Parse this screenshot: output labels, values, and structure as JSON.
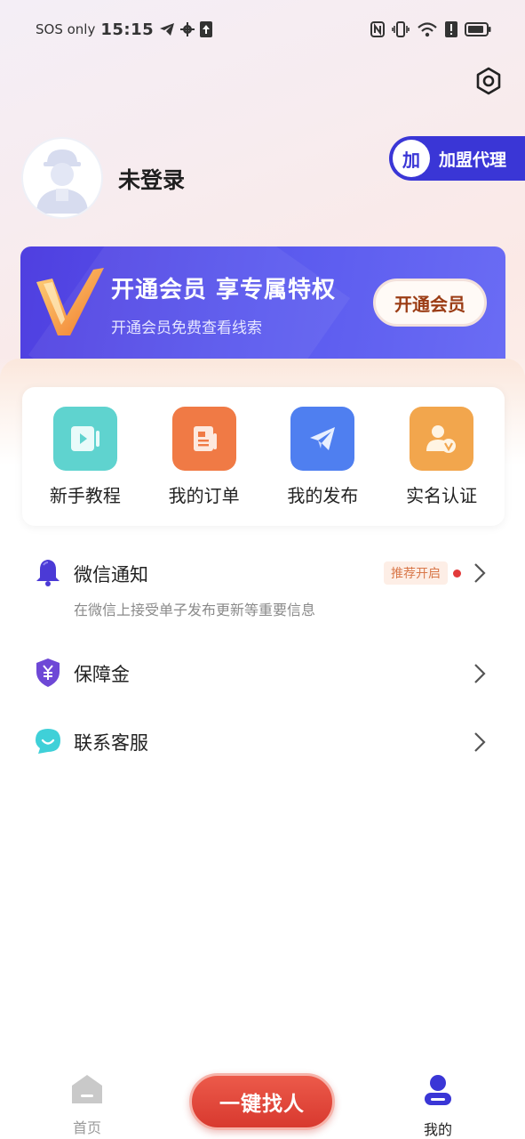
{
  "status_bar": {
    "carrier": "SOS only",
    "time": "15:15",
    "icons": [
      "telegram-icon",
      "gear-icon",
      "upload-icon",
      "nfc-icon",
      "vibrate-icon",
      "wifi-icon",
      "alert-icon",
      "battery-icon"
    ]
  },
  "profile": {
    "username": "未登录",
    "agent_badge": "加",
    "agent_label": "加盟代理"
  },
  "vip": {
    "title": "开通会员 享专属特权",
    "subtitle": "开通会员免费查看线索",
    "button": "开通会员"
  },
  "shortcuts": [
    {
      "label": "新手教程",
      "icon": "video-tutorial-icon",
      "color": "#5fd3cf"
    },
    {
      "label": "我的订单",
      "icon": "order-document-icon",
      "color": "#f07a45"
    },
    {
      "label": "我的发布",
      "icon": "paper-plane-icon",
      "color": "#4f7ff0"
    },
    {
      "label": "实名认证",
      "icon": "verified-user-icon",
      "color": "#f2a64d"
    }
  ],
  "menu": {
    "wechat": {
      "label": "微信通知",
      "description": "在微信上接受单子发布更新等重要信息",
      "tag": "推荐开启"
    },
    "deposit": {
      "label": "保障金"
    },
    "service": {
      "label": "联系客服"
    }
  },
  "tabbar": {
    "home": "首页",
    "find": "一键找人",
    "mine": "我的"
  },
  "colors": {
    "accent": "#3a36d6",
    "vip_banner": "#5a59ee",
    "find_button": "#e04a3d",
    "active_tab": "#3a36d6"
  }
}
